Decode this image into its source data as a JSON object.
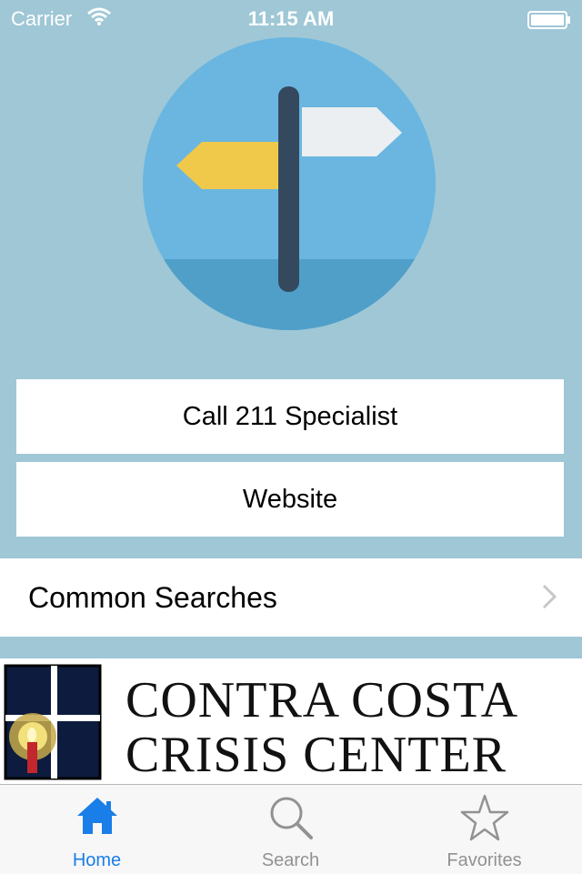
{
  "status_bar": {
    "carrier": "Carrier",
    "time": "11:15 AM"
  },
  "actions": {
    "call_label": "Call 211 Specialist",
    "website_label": "Website"
  },
  "common_searches": {
    "label": "Common Searches"
  },
  "banner": {
    "line1": "CONTRA COSTA",
    "line2": "CRISIS CENTER"
  },
  "tabs": [
    {
      "label": "Home",
      "icon": "home-icon",
      "active": true
    },
    {
      "label": "Search",
      "icon": "search-icon",
      "active": false
    },
    {
      "label": "Favorites",
      "icon": "star-icon",
      "active": false
    }
  ],
  "colors": {
    "background": "#9fc7d6",
    "accent": "#1a7ee8",
    "inactive": "#929292"
  }
}
